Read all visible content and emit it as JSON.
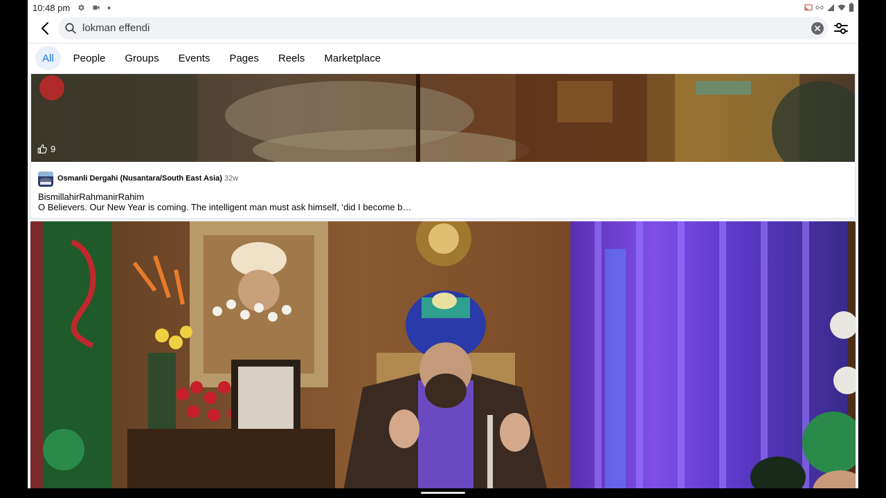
{
  "status": {
    "time": "10:48 pm"
  },
  "search": {
    "query": "lokman effendi"
  },
  "tabs": [
    "All",
    "People",
    "Groups",
    "Events",
    "Pages",
    "Reels",
    "Marketplace"
  ],
  "post": {
    "like_count": "9",
    "author": "Osmanli Dergahi (Nusantara/South East Asia)",
    "age": "32w",
    "line1": "BismillahirRahmanirRahim",
    "line2": "O Believers. Our New Year is coming. The intelligent man must ask himself, ‘did I become b…"
  },
  "colors": {
    "accent": "#1b74e4",
    "tab_active_bg": "#e7f0fb",
    "search_bg": "#f0f2f5"
  }
}
